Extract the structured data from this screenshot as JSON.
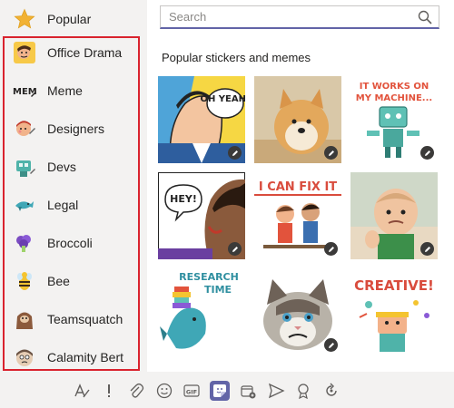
{
  "sidebar": {
    "popular": {
      "label": "Popular",
      "icon": "star-icon"
    },
    "categories": [
      {
        "label": "Office Drama",
        "icon": "office-drama-icon"
      },
      {
        "label": "Meme",
        "icon": "meme-icon"
      },
      {
        "label": "Designers",
        "icon": "designers-icon"
      },
      {
        "label": "Devs",
        "icon": "devs-icon"
      },
      {
        "label": "Legal",
        "icon": "legal-icon"
      },
      {
        "label": "Broccoli",
        "icon": "broccoli-icon"
      },
      {
        "label": "Bee",
        "icon": "bee-icon"
      },
      {
        "label": "Teamsquatch",
        "icon": "teamsquatch-icon"
      },
      {
        "label": "Calamity Bert",
        "icon": "calamity-bert-icon"
      }
    ]
  },
  "search": {
    "placeholder": "Search",
    "value": ""
  },
  "section": {
    "title": "Popular stickers and memes"
  },
  "stickers": [
    {
      "caption": "OH YEAH!"
    },
    {
      "caption": ""
    },
    {
      "caption": "IT WORKS ON MY MACHINE..."
    },
    {
      "caption": "HEY!"
    },
    {
      "caption": "I CAN FIX IT"
    },
    {
      "caption": ""
    },
    {
      "caption": "RESEARCH TIME"
    },
    {
      "caption": ""
    },
    {
      "caption": "CREATIVE!"
    }
  ],
  "toolbar": {
    "buttons": [
      "format-icon",
      "important-icon",
      "attach-icon",
      "emoji-icon",
      "gif-icon",
      "sticker-icon",
      "meet-now-icon",
      "send-icon",
      "praise-icon",
      "loop-icon"
    ],
    "gif_label": "GIF"
  },
  "colors": {
    "accent": "#6264a7",
    "highlight": "#d9232e",
    "panel": "#f3f2f1"
  }
}
